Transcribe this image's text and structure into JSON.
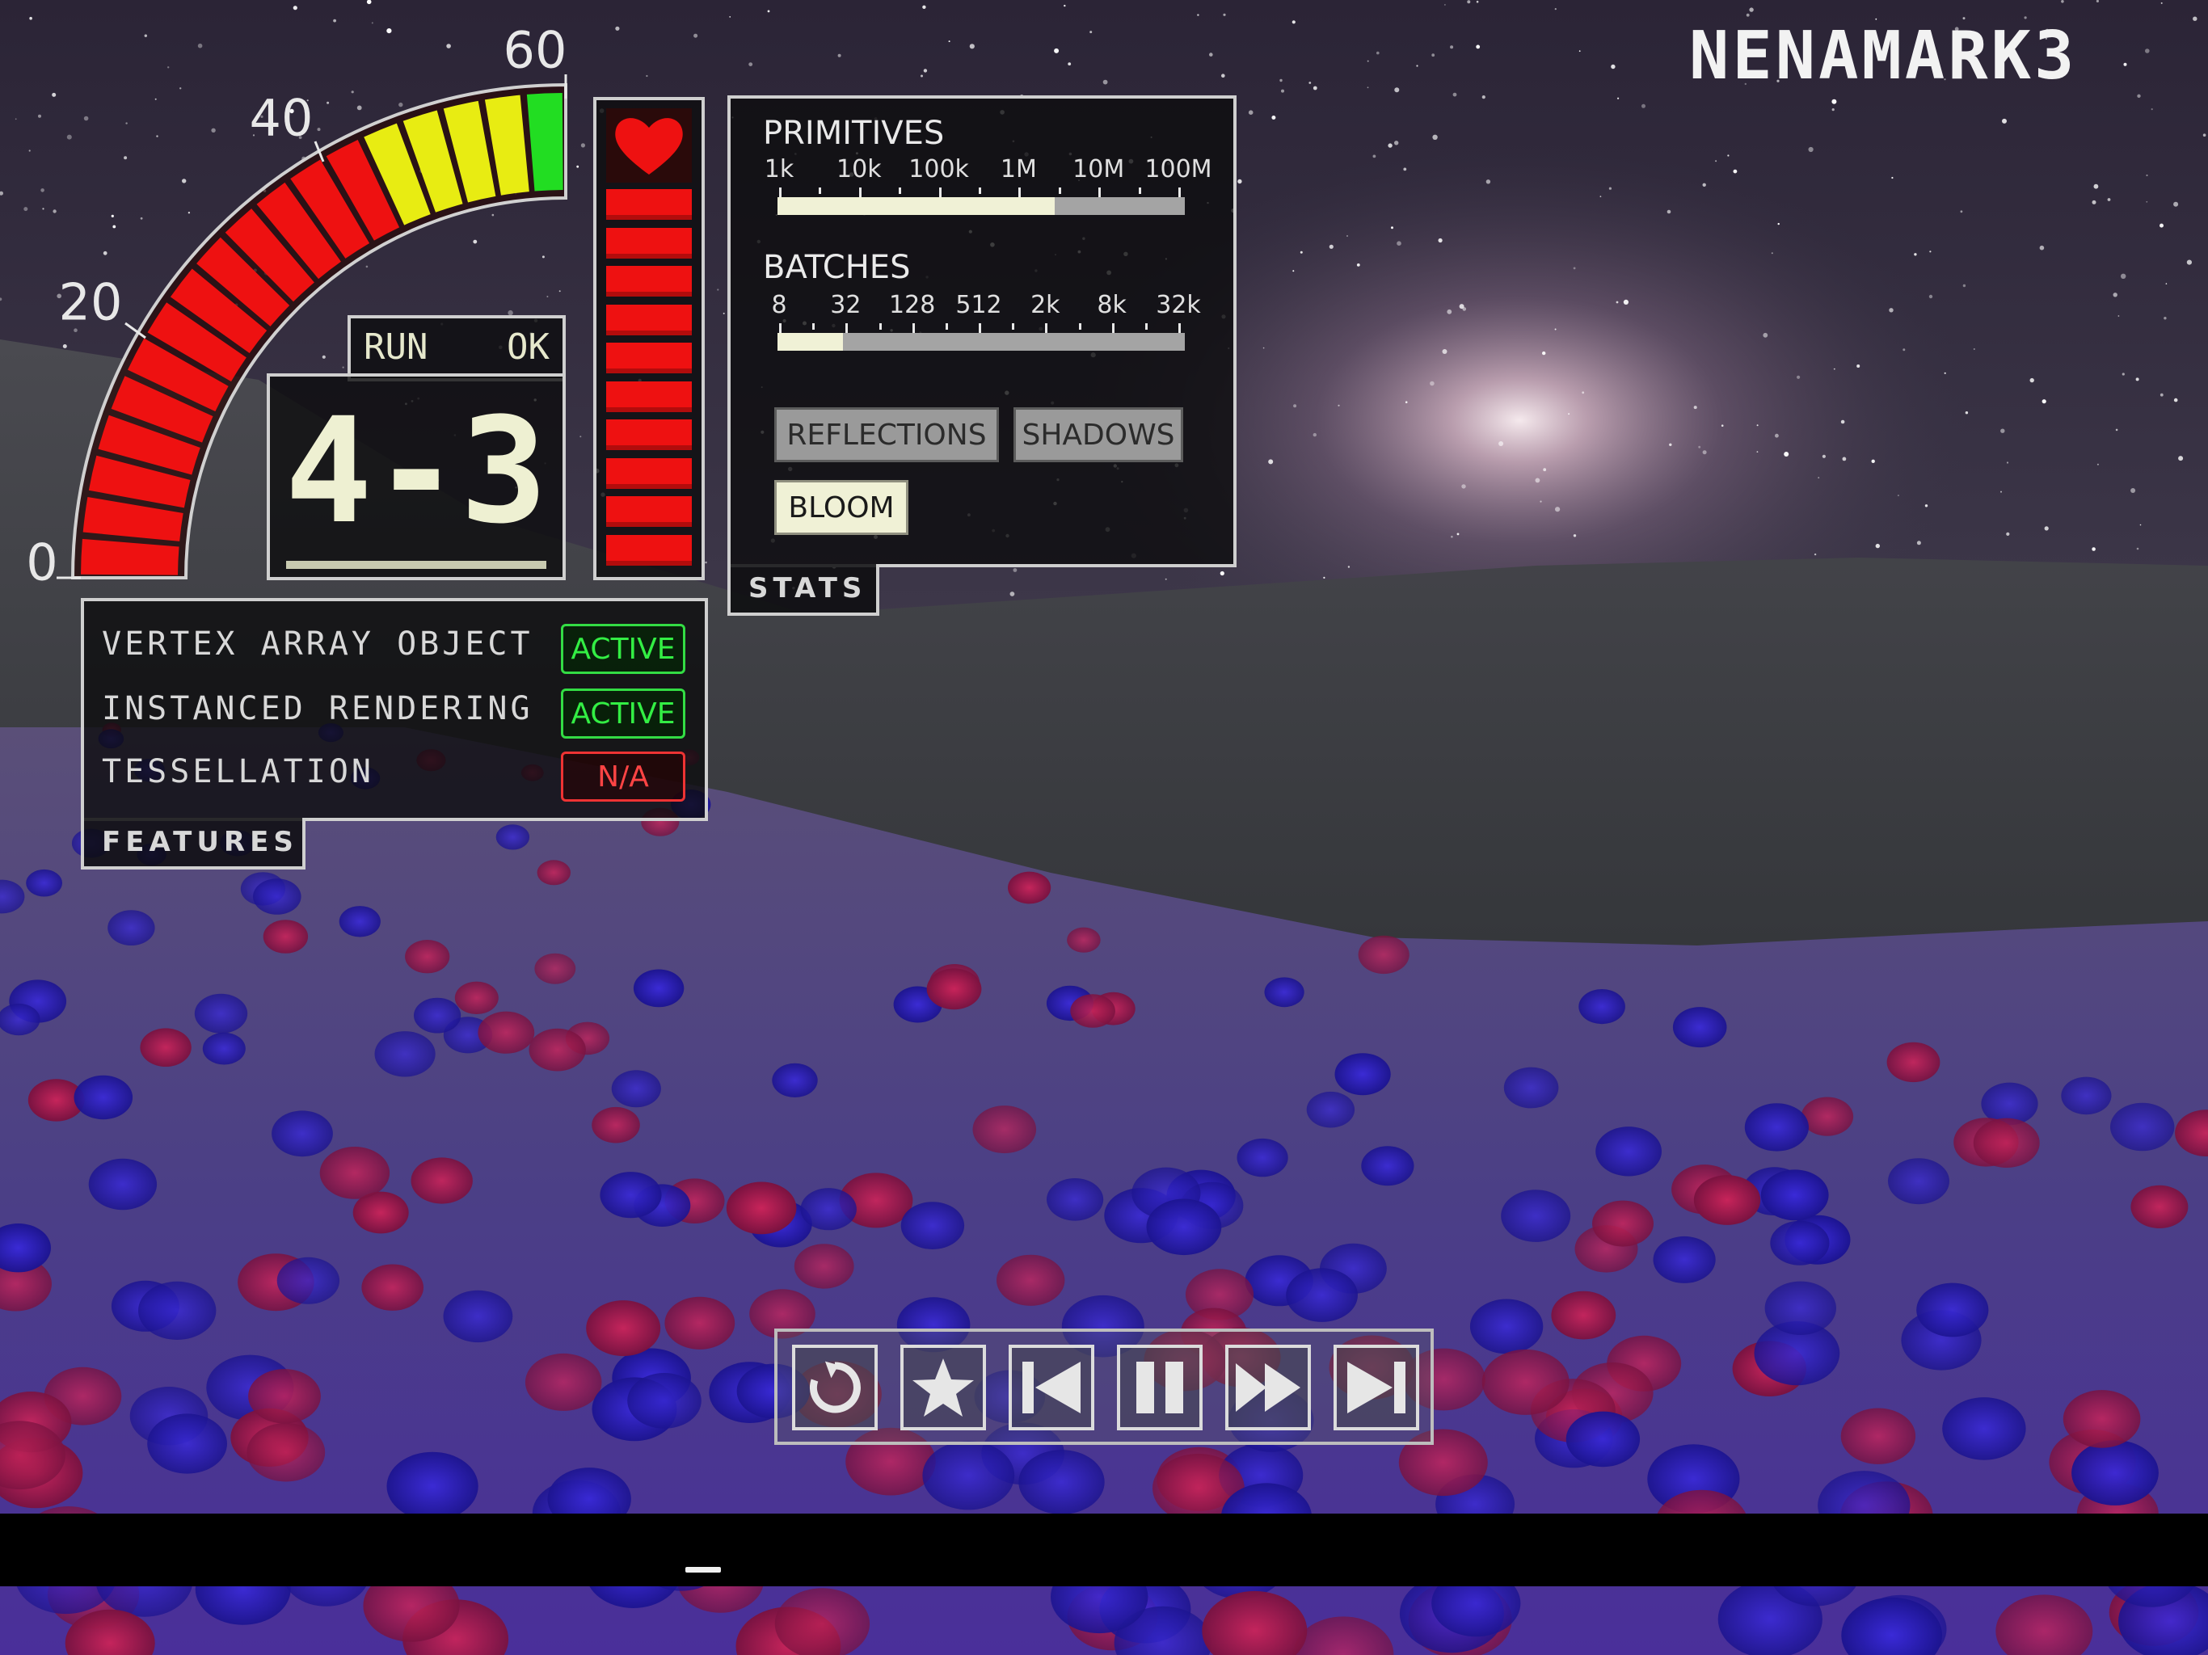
{
  "app": {
    "logo_text": "NENAMARK3"
  },
  "gauge": {
    "labels": [
      "0",
      "20",
      "40",
      "60"
    ],
    "segment_count": 18,
    "colors": {
      "red": "#ee1111",
      "yellow": "#e8ec12",
      "green": "#22dd22"
    }
  },
  "display": {
    "run_label": "RUN",
    "ok_label": "OK",
    "level": "4-3"
  },
  "health": {
    "segments": 10,
    "icon": "heart-icon",
    "color": "#ee1111"
  },
  "stats": {
    "tab_label": "STATS",
    "primitives": {
      "title": "PRIMITIVES",
      "ticks": [
        "1k",
        "10k",
        "100k",
        "1M",
        "10M",
        "100M"
      ],
      "fill_fraction": 0.68
    },
    "batches": {
      "title": "BATCHES",
      "ticks": [
        "8",
        "32",
        "128",
        "512",
        "2k",
        "8k",
        "32k"
      ],
      "fill_fraction": 0.16
    },
    "toggles": [
      {
        "label": "REFLECTIONS",
        "state": "off"
      },
      {
        "label": "SHADOWS",
        "state": "off"
      },
      {
        "label": "BLOOM",
        "state": "on"
      }
    ]
  },
  "features": {
    "tab_label": "FEATURES",
    "items": [
      {
        "label": "VERTEX ARRAY OBJECT",
        "status": "ACTIVE"
      },
      {
        "label": "INSTANCED RENDERING",
        "status": "ACTIVE"
      },
      {
        "label": "TESSELLATION",
        "status": "N/A"
      }
    ]
  },
  "controls": {
    "buttons": [
      {
        "name": "restart-button",
        "icon": "restart-icon"
      },
      {
        "name": "favorite-button",
        "icon": "star-icon"
      },
      {
        "name": "previous-button",
        "icon": "skip-back-icon"
      },
      {
        "name": "pause-button",
        "icon": "pause-icon"
      },
      {
        "name": "fast-forward-button",
        "icon": "fast-forward-icon"
      },
      {
        "name": "next-button",
        "icon": "skip-forward-icon"
      }
    ]
  }
}
